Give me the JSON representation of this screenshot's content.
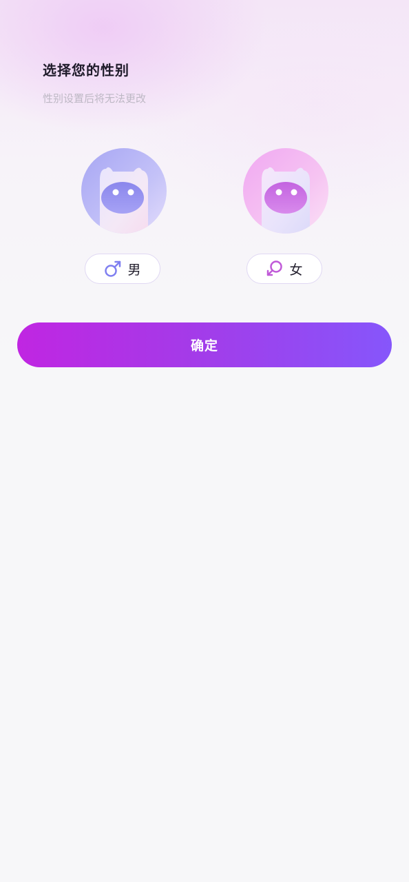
{
  "header": {
    "title": "选择您的性别",
    "subtitle": "性别设置后将无法更改"
  },
  "options": [
    {
      "label": "男",
      "icon": "male-symbol-icon",
      "accent": "#7f7ff0"
    },
    {
      "label": "女",
      "icon": "female-symbol-icon",
      "accent": "#c05ad8"
    }
  ],
  "confirm": {
    "label": "确定",
    "gradient_start": "#c026e2",
    "gradient_end": "#8656fb"
  }
}
